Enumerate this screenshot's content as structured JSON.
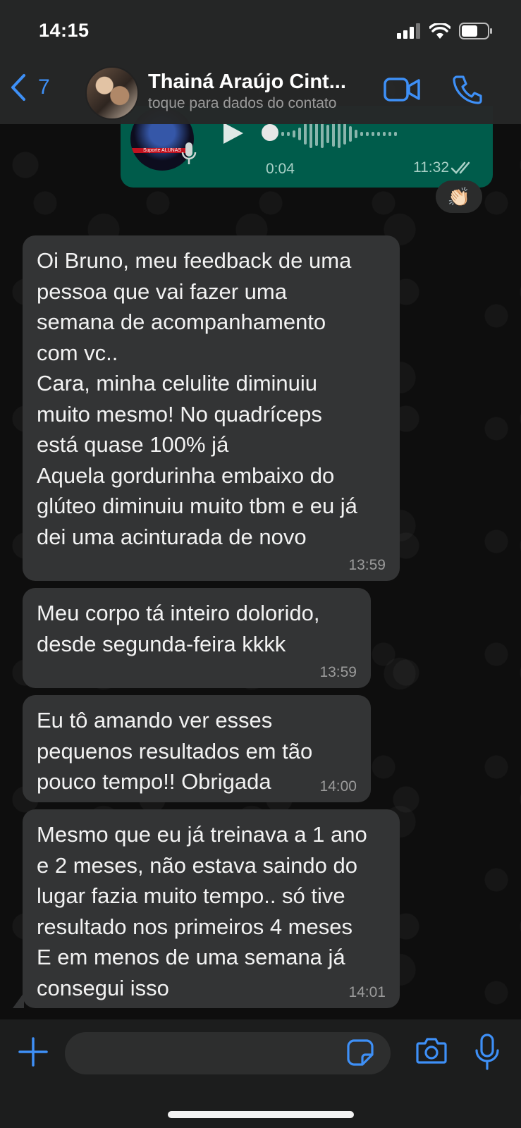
{
  "status_bar": {
    "time": "14:15"
  },
  "header": {
    "back_count": "7",
    "contact_name": "Thainá Araújo Cint...",
    "contact_subtitle": "toque para dados do contato"
  },
  "audio_message": {
    "thumb_label": "Suporte ALUNAS",
    "duration": "0:04",
    "time": "11:32",
    "reaction": "👏🏻"
  },
  "messages": [
    {
      "text": "Oi Bruno, meu feedback de uma\npessoa que vai fazer uma\nsemana de acompanhamento\ncom vc..\nCara, minha celulite diminuiu\nmuito mesmo! No quadríceps\nestá quase 100% já\nAquela gordurinha embaixo do\nglúteo diminuiu muito tbm e eu já\ndei uma acinturada de novo",
      "time": "13:59"
    },
    {
      "text": "Meu corpo tá inteiro dolorido,\ndesde segunda-feira kkkk",
      "time": "13:59"
    },
    {
      "text": "Eu tô amando ver esses\npequenos resultados em tão\npouco tempo!! Obrigada",
      "time": "14:00"
    },
    {
      "text": "Mesmo que eu já treinava a 1 ano\ne 2 meses, não estava saindo do\nlugar fazia muito tempo.. só tive\nresultado nos primeiros 4 meses\nE em menos de uma semana já\nconsegui isso",
      "time": "14:01"
    }
  ],
  "composer": {
    "placeholder": ""
  },
  "colors": {
    "accent": "#3e90f7",
    "outgoing_bubble": "#005c4b",
    "incoming_bubble": "#333435",
    "background": "#0b0b0b"
  }
}
